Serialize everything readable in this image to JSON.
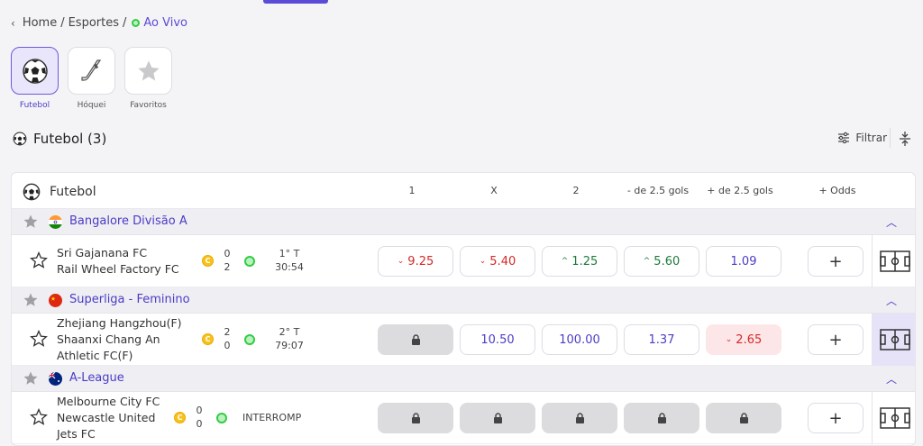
{
  "breadcrumb": {
    "home": "Home",
    "sep1": "/",
    "sports": "Esportes",
    "sep2": "/",
    "live": "Ao Vivo"
  },
  "sports": [
    {
      "label": "Futebol",
      "icon": "soccer-ball-icon",
      "active": true
    },
    {
      "label": "Hóquei",
      "icon": "hockey-stick-icon",
      "active": false
    },
    {
      "label": "Favoritos",
      "icon": "star-icon",
      "active": false
    }
  ],
  "section": {
    "title": "Futebol (3)",
    "filter_label": "Filtrar"
  },
  "table": {
    "sport": "Futebol",
    "columns": [
      "1",
      "X",
      "2",
      "- de 2.5 gols",
      "+ de 2.5 gols",
      "+ Odds"
    ]
  },
  "leagues": [
    {
      "name": "Bangalore Divisão A",
      "flag": "india-flag",
      "match": {
        "home": "Sri Gajanana FC",
        "away": "Rail Wheel Factory FC",
        "score_home": "0",
        "score_away": "2",
        "period": "1° T",
        "clock": "30:54",
        "odds": [
          {
            "value": "9.25",
            "trend": "down"
          },
          {
            "value": "5.40",
            "trend": "down"
          },
          {
            "value": "1.25",
            "trend": "up"
          },
          {
            "value": "5.60",
            "trend": "up"
          },
          {
            "value": "1.09",
            "trend": "none"
          }
        ],
        "more": "+"
      }
    },
    {
      "name": "Superliga - Feminino",
      "flag": "china-flag",
      "match": {
        "home": "Zhejiang Hangzhou(F)",
        "away_line1": "Shaanxi Chang An",
        "away_line2": "Athletic FC(F)",
        "score_home": "2",
        "score_away": "0",
        "period": "2° T",
        "clock": "79:07",
        "odds": [
          {
            "value": "",
            "trend": "locked"
          },
          {
            "value": "10.50",
            "trend": "none"
          },
          {
            "value": "100.00",
            "trend": "none"
          },
          {
            "value": "1.37",
            "trend": "none"
          },
          {
            "value": "2.65",
            "trend": "down"
          }
        ],
        "more": "+"
      }
    },
    {
      "name": "A-League",
      "flag": "australia-flag",
      "match": {
        "home": "Melbourne City FC",
        "away_line1": "Newcastle United",
        "away_line2": "Jets FC",
        "score_home": "0",
        "score_away": "0",
        "status": "INTERROMP",
        "more": "+"
      }
    }
  ],
  "colors": {
    "accent": "#5b4bd6",
    "down": "#d42a2a",
    "up": "#1e7a3c",
    "live": "#33cc44"
  }
}
